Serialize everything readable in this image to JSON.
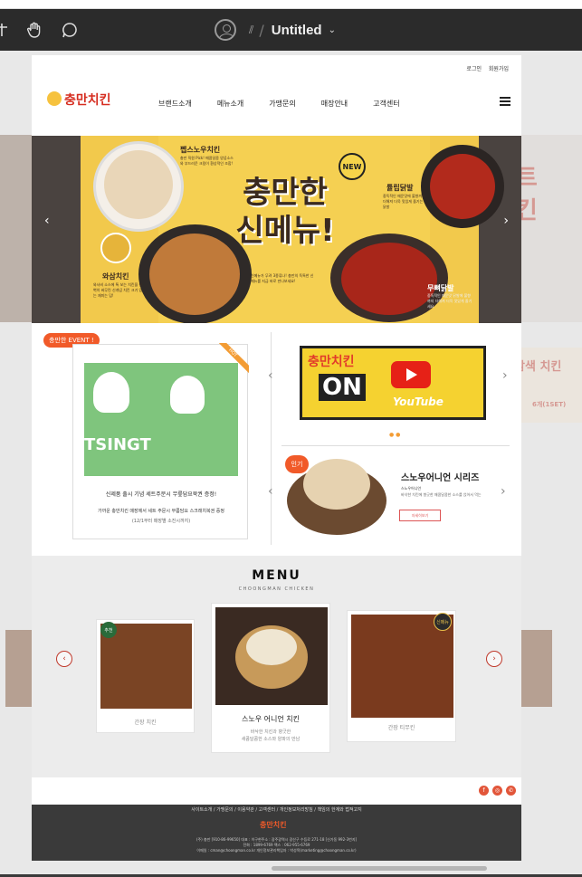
{
  "toolbar": {
    "doc_title": "Untitled",
    "separator": "⫽",
    "slash": "/",
    "caret": "⌄"
  },
  "site": {
    "util_links": [
      "로그인",
      "회원가입"
    ],
    "logo_text": "충만치킨",
    "nav": [
      "브랜드소개",
      "메뉴소개",
      "가맹문의",
      "매장안내",
      "고객센터"
    ],
    "hero": {
      "title_line1": "충만한",
      "title_line2": "신메뉴!",
      "new_badge": "NEW",
      "label_snow": "펩스노우치킨",
      "label_tulip": "튤립닭발",
      "label_wasabi": "와삼치킨",
      "label_boneless": "무뼈닭발",
      "snow_desc": "충만 직원 Pick! 매콤달콤 양념소스와 부드러운 크림이 환상적인 조합!",
      "tulip_desc": "중독적인 매운맛에 불향까지 더해져 더욱 맛있게 즐기는 닭발",
      "center_desc": "신메뉴가 무려 3종류나! 충만의 독특한 신메뉴를 지금 바로 만나보세요!",
      "wasabi_desc": "와사비 소스에 톡 쏘는 치킨을 완벽히 버무린 신개념 치킨 크기 있는 재미는 덤!",
      "boneless_desc": "중독적인 매운맛 닭발에 불향까지 더해져 더욱 맛있게 즐기세요"
    },
    "event": {
      "tag": "충만한 EVENT !",
      "hot": "HOT",
      "line1": "신제품 출시 기념 세트주문시 무릎담요북권 증정!",
      "line2": "가까운 충만치킨 매장에서 세트 주문시 무릎담요 스크래치복권 증정",
      "line3": "(12/1부터 매장별 소진시까지)",
      "img_text": "TSINGT"
    },
    "youtube": {
      "brand": "충만치킨",
      "on": "ON",
      "yt": "YouTube",
      "side_title": "삼색 치킨",
      "side_badge": "6개(1SET)"
    },
    "popular": {
      "tag": "인기",
      "title": "스노우어니언 시리즈",
      "sub1": "스노우어니언",
      "sub2": "바삭한 치킨에 향긋한 매콤달콤한 소스를 얹어서 먹는",
      "button": "자세히보기"
    },
    "menu": {
      "title": "MENU",
      "subtitle": "CHOONGMAN CHICKEN",
      "center_name": "스노우 어니언 치킨",
      "center_desc1": "바삭한 치킨과 향긋한",
      "center_desc2": "새콤달콤한 소스와 양파의 만남",
      "left_name": "간장 치킨",
      "right_name": "간장 티무킨",
      "left_badge": "추천",
      "right_badge": "신메뉴"
    },
    "footer": {
      "links": "사이트소개 / 가맹문의 / 이용약관 / 고객센터 / 개인정보처리방침 / 책임의 한계와 법적고지",
      "logo": "충만치킨",
      "info1": "(주) 충만 [910-86-99650] 대표 : 이구현주소 : 광주광역시 광산구 수등로 271-18 [신가동 992-3번지]",
      "info2": "전화 : 1899-6769    팩스 : 062-955-6769",
      "info3": "이메일 : cman@choongman.co.kr    개인정보관리책임자 : 박성목(marketing@choongman.co.kr)"
    },
    "social_icons": [
      "f",
      "◎",
      "✆"
    ]
  }
}
